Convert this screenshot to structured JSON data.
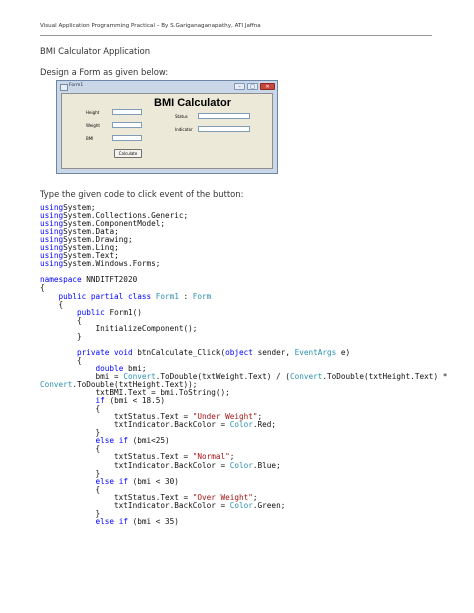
{
  "header": "Visual Application Programming Practical – By S.Gariganaganapathy, ATI Jaffna",
  "headings": {
    "title": "BMI Calculator Application",
    "design": "Design a Form as given below:",
    "code_intro": "Type the given code to click event of the button:"
  },
  "form_screenshot": {
    "window_title": "Form1",
    "heading": "BMI Calculator",
    "labels": {
      "height": "Height",
      "weight": "Weight",
      "bmi": "BMI",
      "status": "Status",
      "indicator": "Indicator"
    },
    "button": "Calculate",
    "controls": [
      "–",
      "□",
      "✕"
    ]
  },
  "code": [
    [
      [
        "kw",
        "using"
      ],
      [
        "",
        "System;"
      ]
    ],
    [
      [
        "kw",
        "using"
      ],
      [
        "",
        "System.Collections.Generic;"
      ]
    ],
    [
      [
        "kw",
        "using"
      ],
      [
        "",
        "System.ComponentModel;"
      ]
    ],
    [
      [
        "kw",
        "using"
      ],
      [
        "",
        "System.Data;"
      ]
    ],
    [
      [
        "kw",
        "using"
      ],
      [
        "",
        "System.Drawing;"
      ]
    ],
    [
      [
        "kw",
        "using"
      ],
      [
        "",
        "System.Linq;"
      ]
    ],
    [
      [
        "kw",
        "using"
      ],
      [
        "",
        "System.Text;"
      ]
    ],
    [
      [
        "kw",
        "using"
      ],
      [
        "",
        "System.Windows.Forms;"
      ]
    ],
    [],
    [
      [
        "kw",
        "namespace"
      ],
      [
        "",
        " NNDITFT2020"
      ]
    ],
    [
      [
        "",
        "{"
      ]
    ],
    [
      [
        "",
        "    "
      ],
      [
        "kw",
        "public partial class"
      ],
      [
        "",
        " "
      ],
      [
        "ty",
        "Form1"
      ],
      [
        "",
        " : "
      ],
      [
        "ty",
        "Form"
      ]
    ],
    [
      [
        "",
        "    {"
      ]
    ],
    [
      [
        "",
        "        "
      ],
      [
        "kw",
        "public"
      ],
      [
        "",
        " Form1()"
      ]
    ],
    [
      [
        "",
        "        {"
      ]
    ],
    [
      [
        "",
        "            InitializeComponent();"
      ]
    ],
    [
      [
        "",
        "        }"
      ]
    ],
    [],
    [
      [
        "",
        "        "
      ],
      [
        "kw",
        "private void"
      ],
      [
        "",
        " btnCalculate_Click("
      ],
      [
        "kw",
        "object"
      ],
      [
        "",
        " sender, "
      ],
      [
        "ty",
        "EventArgs"
      ],
      [
        "",
        " e)"
      ]
    ],
    [
      [
        "",
        "        {"
      ]
    ],
    [
      [
        "",
        "            "
      ],
      [
        "kw",
        "double"
      ],
      [
        "",
        " bmi;"
      ]
    ],
    [
      [
        "",
        "            bmi = "
      ],
      [
        "ty",
        "Convert"
      ],
      [
        "",
        ".ToDouble(txtWeight.Text) / ("
      ],
      [
        "ty",
        "Convert"
      ],
      [
        "",
        ".ToDouble(txtHeight.Text) *"
      ]
    ],
    [
      [
        "ty",
        "Convert"
      ],
      [
        "",
        ".ToDouble(txtHeight.Text));"
      ]
    ],
    [
      [
        "",
        "            txtBMI.Text = bmi.ToString();"
      ]
    ],
    [
      [
        "",
        "            "
      ],
      [
        "kw",
        "if"
      ],
      [
        "",
        " (bmi < 18.5)"
      ]
    ],
    [
      [
        "",
        "            {"
      ]
    ],
    [
      [
        "",
        "                txtStatus.Text = "
      ],
      [
        "st",
        "\"Under Weight\""
      ],
      [
        "",
        ";"
      ]
    ],
    [
      [
        "",
        "                txtIndicator.BackColor = "
      ],
      [
        "ty",
        "Color"
      ],
      [
        "",
        ".Red;"
      ]
    ],
    [
      [
        "",
        "            }"
      ]
    ],
    [
      [
        "",
        "            "
      ],
      [
        "kw",
        "else if"
      ],
      [
        "",
        " (bmi<25)"
      ]
    ],
    [
      [
        "",
        "            {"
      ]
    ],
    [
      [
        "",
        "                txtStatus.Text = "
      ],
      [
        "st",
        "\"Normal\""
      ],
      [
        "",
        ";"
      ]
    ],
    [
      [
        "",
        "                txtIndicator.BackColor = "
      ],
      [
        "ty",
        "Color"
      ],
      [
        "",
        ".Blue;"
      ]
    ],
    [
      [
        "",
        "            }"
      ]
    ],
    [
      [
        "",
        "            "
      ],
      [
        "kw",
        "else if"
      ],
      [
        "",
        " (bmi < 30)"
      ]
    ],
    [
      [
        "",
        "            {"
      ]
    ],
    [
      [
        "",
        "                txtStatus.Text = "
      ],
      [
        "st",
        "\"Over Weight\""
      ],
      [
        "",
        ";"
      ]
    ],
    [
      [
        "",
        "                txtIndicator.BackColor = "
      ],
      [
        "ty",
        "Color"
      ],
      [
        "",
        ".Green;"
      ]
    ],
    [
      [
        "",
        "            }"
      ]
    ],
    [
      [
        "",
        "            "
      ],
      [
        "kw",
        "else if"
      ],
      [
        "",
        " (bmi < 35)"
      ]
    ]
  ]
}
